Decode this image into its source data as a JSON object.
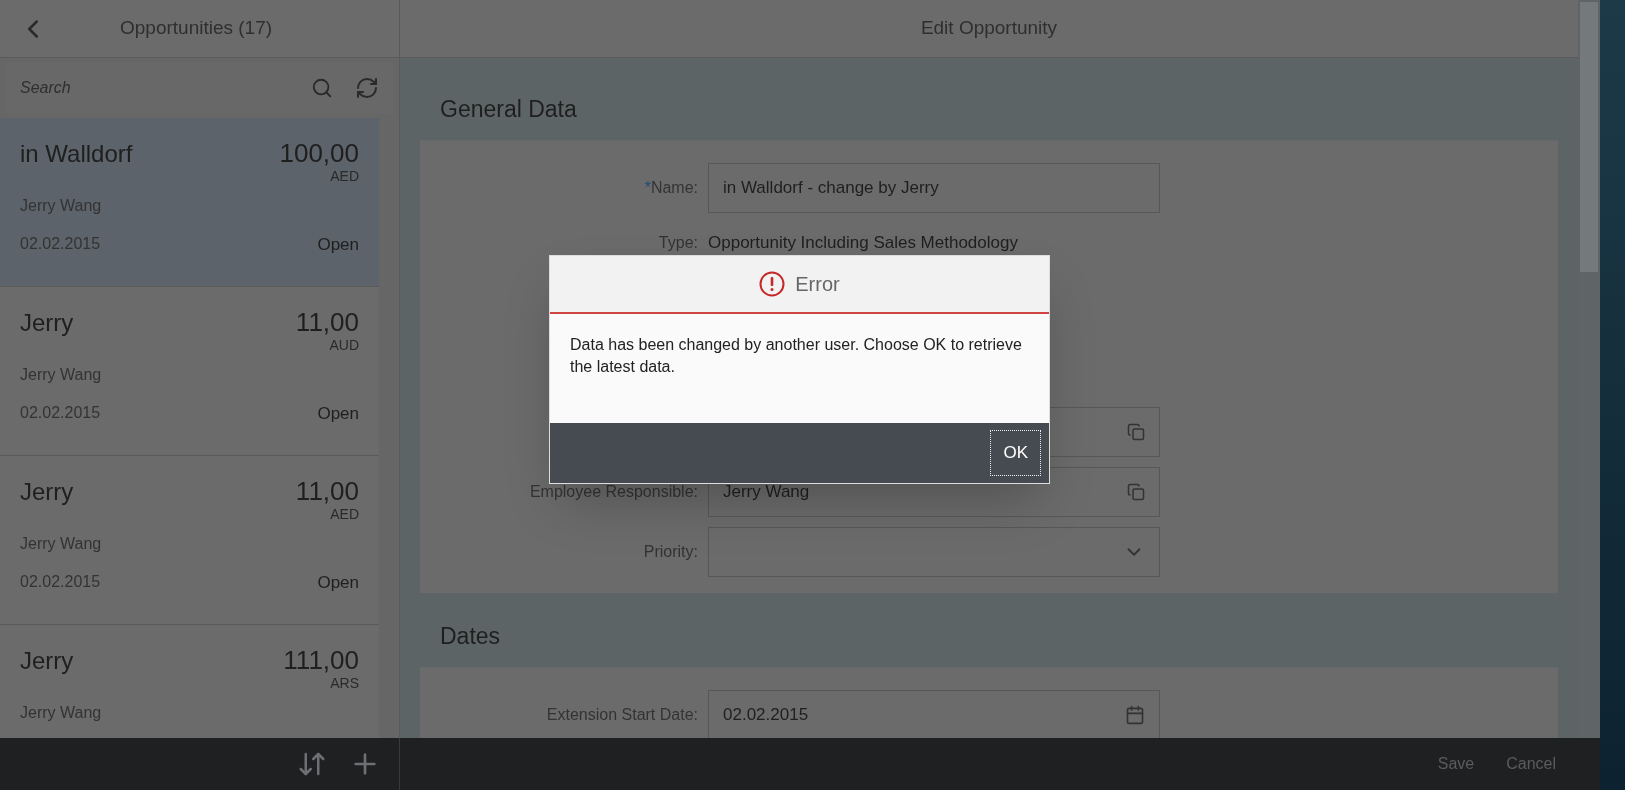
{
  "master": {
    "title": "Opportunities (17)",
    "search": {
      "placeholder": "Search"
    },
    "items": [
      {
        "name": "in Walldorf",
        "amount": "100,00",
        "currency": "AED",
        "owner": "Jerry Wang",
        "date": "02.02.2015",
        "status": "Open",
        "selected": true
      },
      {
        "name": "Jerry",
        "amount": "11,00",
        "currency": "AUD",
        "owner": "Jerry Wang",
        "date": "02.02.2015",
        "status": "Open",
        "selected": false
      },
      {
        "name": "Jerry",
        "amount": "11,00",
        "currency": "AED",
        "owner": "Jerry Wang",
        "date": "02.02.2015",
        "status": "Open",
        "selected": false
      },
      {
        "name": "Jerry",
        "amount": "111,00",
        "currency": "ARS",
        "owner": "Jerry Wang",
        "selected": false
      }
    ]
  },
  "detail": {
    "title": "Edit Opportunity",
    "sections": [
      {
        "title": "General Data",
        "fields": [
          {
            "kind": "input",
            "required_mark": "*",
            "label": "Name:",
            "value": "in Walldorf - change by Jerry"
          },
          {
            "kind": "text",
            "label": "Type:",
            "value": "Opportunity Including Sales Methodology"
          },
          {
            "kind": "value-help"
          },
          {
            "kind": "value-help",
            "label": "Employee Responsible:",
            "value": "Jerry Wang"
          },
          {
            "kind": "select",
            "label": "Priority:"
          }
        ]
      },
      {
        "title": "Dates",
        "fields": [
          {
            "kind": "date",
            "label": "Extension Start Date:",
            "value": "02.02.2015"
          }
        ]
      }
    ]
  },
  "footer": {
    "buttons": [
      "Save",
      "Cancel"
    ]
  },
  "dialog": {
    "title": "Error",
    "message": "Data has been changed by another user. Choose OK to retrieve the latest data.",
    "buttons": [
      "OK"
    ]
  }
}
